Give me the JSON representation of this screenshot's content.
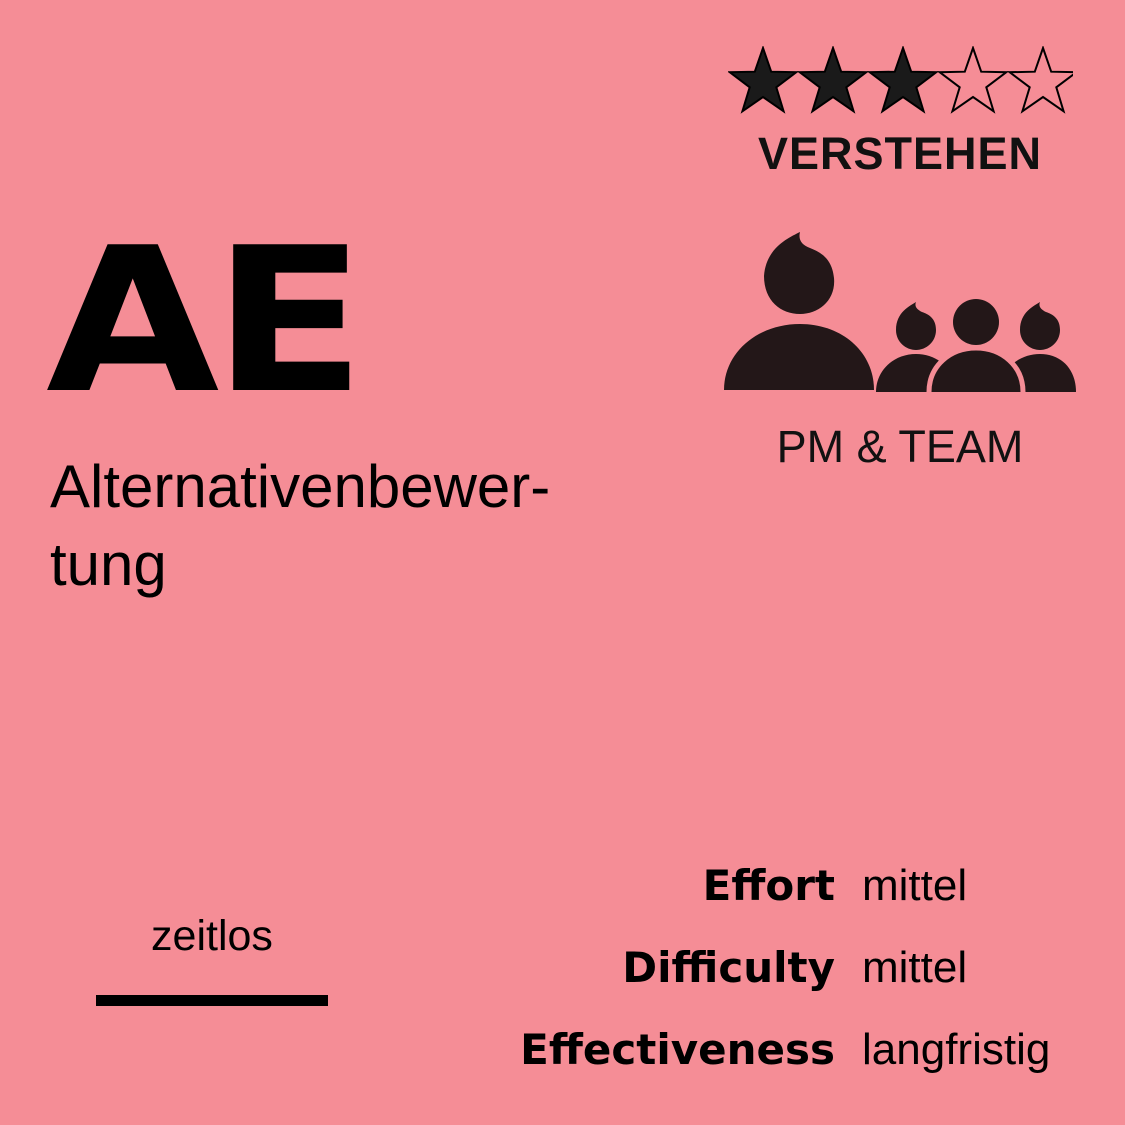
{
  "card": {
    "background_color": "#f58d96",
    "ink_color": "#231718",
    "rating": {
      "value": 3,
      "max": 5
    },
    "level": "VERSTEHEN",
    "abbreviation": "AE",
    "name_line1": "Alternativenbewer-",
    "name_line2": "tung",
    "people_icon": "group-people-icon",
    "role": "PM & TEAM",
    "timeframe": "zeitlos",
    "metrics": [
      {
        "label": "Effort",
        "value": "mittel"
      },
      {
        "label": "Difficulty",
        "value": "mittel"
      },
      {
        "label": "Effectiveness",
        "value": "langfristig"
      }
    ]
  }
}
